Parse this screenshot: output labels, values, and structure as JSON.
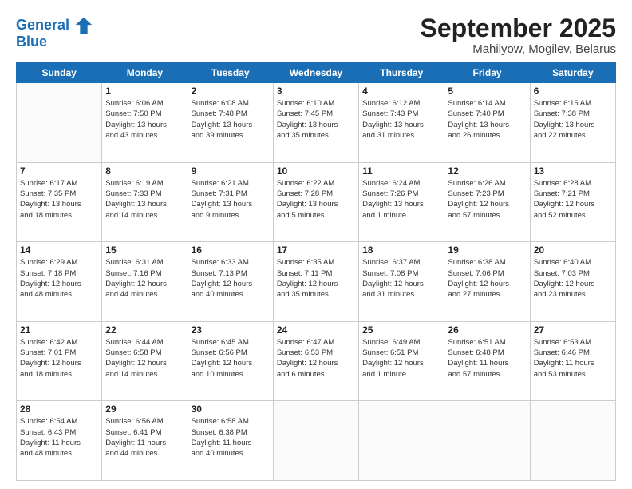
{
  "header": {
    "logo_line1": "General",
    "logo_line2": "Blue",
    "title": "September 2025",
    "location": "Mahilyow, Mogilev, Belarus"
  },
  "days_of_week": [
    "Sunday",
    "Monday",
    "Tuesday",
    "Wednesday",
    "Thursday",
    "Friday",
    "Saturday"
  ],
  "weeks": [
    [
      {
        "day": "",
        "info": ""
      },
      {
        "day": "1",
        "info": "Sunrise: 6:06 AM\nSunset: 7:50 PM\nDaylight: 13 hours\nand 43 minutes."
      },
      {
        "day": "2",
        "info": "Sunrise: 6:08 AM\nSunset: 7:48 PM\nDaylight: 13 hours\nand 39 minutes."
      },
      {
        "day": "3",
        "info": "Sunrise: 6:10 AM\nSunset: 7:45 PM\nDaylight: 13 hours\nand 35 minutes."
      },
      {
        "day": "4",
        "info": "Sunrise: 6:12 AM\nSunset: 7:43 PM\nDaylight: 13 hours\nand 31 minutes."
      },
      {
        "day": "5",
        "info": "Sunrise: 6:14 AM\nSunset: 7:40 PM\nDaylight: 13 hours\nand 26 minutes."
      },
      {
        "day": "6",
        "info": "Sunrise: 6:15 AM\nSunset: 7:38 PM\nDaylight: 13 hours\nand 22 minutes."
      }
    ],
    [
      {
        "day": "7",
        "info": "Sunrise: 6:17 AM\nSunset: 7:35 PM\nDaylight: 13 hours\nand 18 minutes."
      },
      {
        "day": "8",
        "info": "Sunrise: 6:19 AM\nSunset: 7:33 PM\nDaylight: 13 hours\nand 14 minutes."
      },
      {
        "day": "9",
        "info": "Sunrise: 6:21 AM\nSunset: 7:31 PM\nDaylight: 13 hours\nand 9 minutes."
      },
      {
        "day": "10",
        "info": "Sunrise: 6:22 AM\nSunset: 7:28 PM\nDaylight: 13 hours\nand 5 minutes."
      },
      {
        "day": "11",
        "info": "Sunrise: 6:24 AM\nSunset: 7:26 PM\nDaylight: 13 hours\nand 1 minute."
      },
      {
        "day": "12",
        "info": "Sunrise: 6:26 AM\nSunset: 7:23 PM\nDaylight: 12 hours\nand 57 minutes."
      },
      {
        "day": "13",
        "info": "Sunrise: 6:28 AM\nSunset: 7:21 PM\nDaylight: 12 hours\nand 52 minutes."
      }
    ],
    [
      {
        "day": "14",
        "info": "Sunrise: 6:29 AM\nSunset: 7:18 PM\nDaylight: 12 hours\nand 48 minutes."
      },
      {
        "day": "15",
        "info": "Sunrise: 6:31 AM\nSunset: 7:16 PM\nDaylight: 12 hours\nand 44 minutes."
      },
      {
        "day": "16",
        "info": "Sunrise: 6:33 AM\nSunset: 7:13 PM\nDaylight: 12 hours\nand 40 minutes."
      },
      {
        "day": "17",
        "info": "Sunrise: 6:35 AM\nSunset: 7:11 PM\nDaylight: 12 hours\nand 35 minutes."
      },
      {
        "day": "18",
        "info": "Sunrise: 6:37 AM\nSunset: 7:08 PM\nDaylight: 12 hours\nand 31 minutes."
      },
      {
        "day": "19",
        "info": "Sunrise: 6:38 AM\nSunset: 7:06 PM\nDaylight: 12 hours\nand 27 minutes."
      },
      {
        "day": "20",
        "info": "Sunrise: 6:40 AM\nSunset: 7:03 PM\nDaylight: 12 hours\nand 23 minutes."
      }
    ],
    [
      {
        "day": "21",
        "info": "Sunrise: 6:42 AM\nSunset: 7:01 PM\nDaylight: 12 hours\nand 18 minutes."
      },
      {
        "day": "22",
        "info": "Sunrise: 6:44 AM\nSunset: 6:58 PM\nDaylight: 12 hours\nand 14 minutes."
      },
      {
        "day": "23",
        "info": "Sunrise: 6:45 AM\nSunset: 6:56 PM\nDaylight: 12 hours\nand 10 minutes."
      },
      {
        "day": "24",
        "info": "Sunrise: 6:47 AM\nSunset: 6:53 PM\nDaylight: 12 hours\nand 6 minutes."
      },
      {
        "day": "25",
        "info": "Sunrise: 6:49 AM\nSunset: 6:51 PM\nDaylight: 12 hours\nand 1 minute."
      },
      {
        "day": "26",
        "info": "Sunrise: 6:51 AM\nSunset: 6:48 PM\nDaylight: 11 hours\nand 57 minutes."
      },
      {
        "day": "27",
        "info": "Sunrise: 6:53 AM\nSunset: 6:46 PM\nDaylight: 11 hours\nand 53 minutes."
      }
    ],
    [
      {
        "day": "28",
        "info": "Sunrise: 6:54 AM\nSunset: 6:43 PM\nDaylight: 11 hours\nand 48 minutes."
      },
      {
        "day": "29",
        "info": "Sunrise: 6:56 AM\nSunset: 6:41 PM\nDaylight: 11 hours\nand 44 minutes."
      },
      {
        "day": "30",
        "info": "Sunrise: 6:58 AM\nSunset: 6:38 PM\nDaylight: 11 hours\nand 40 minutes."
      },
      {
        "day": "",
        "info": ""
      },
      {
        "day": "",
        "info": ""
      },
      {
        "day": "",
        "info": ""
      },
      {
        "day": "",
        "info": ""
      }
    ]
  ]
}
